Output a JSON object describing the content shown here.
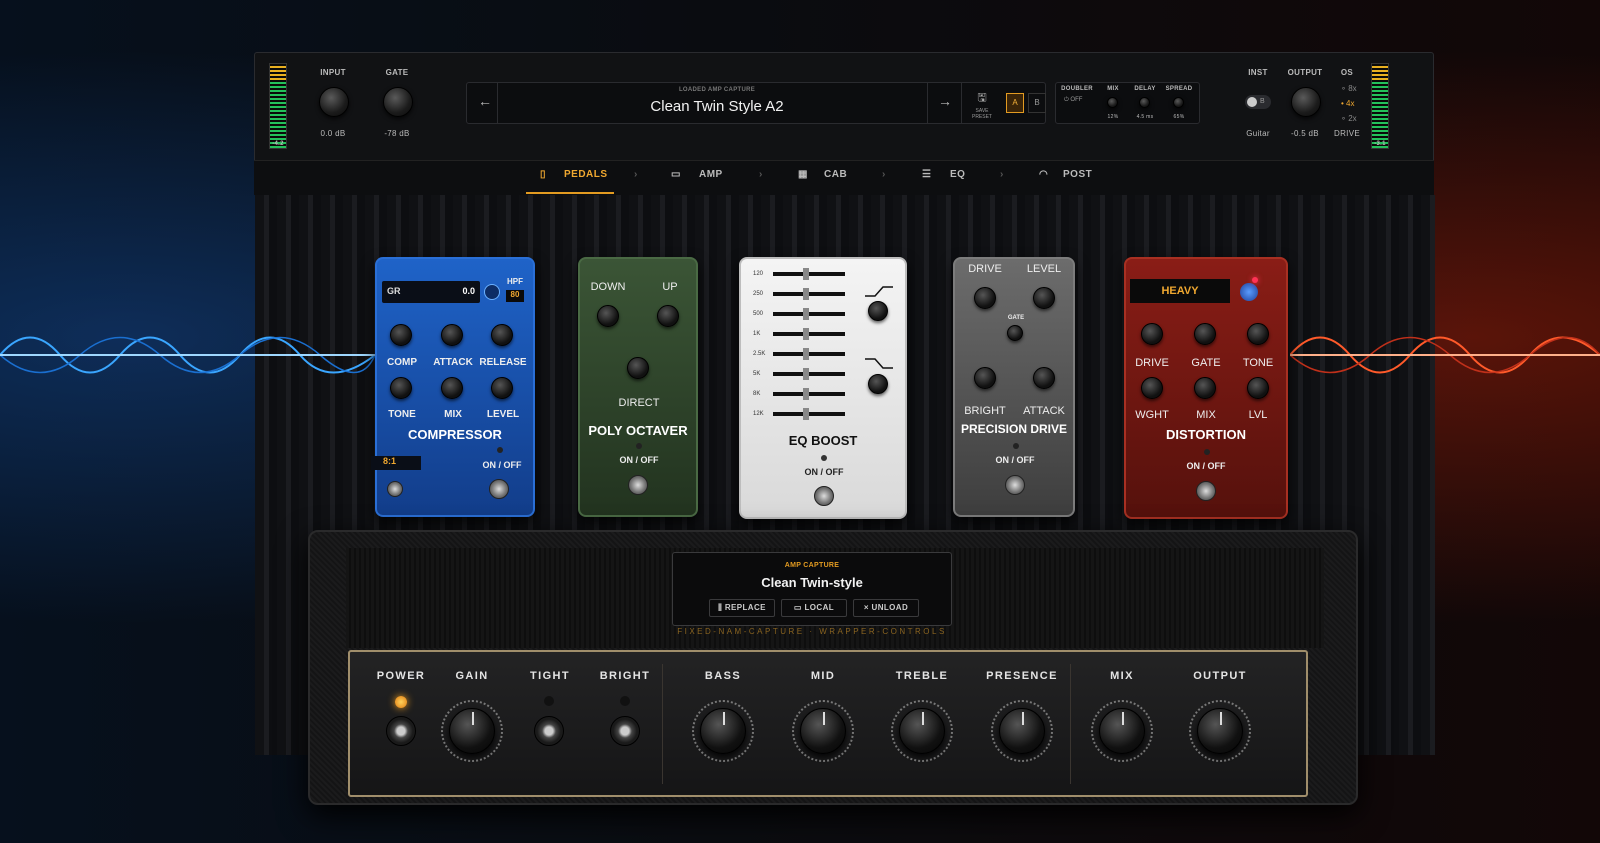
{
  "header": {
    "left_meter_value": "-4.2",
    "right_meter_value": "-3.1",
    "input": {
      "label": "INPUT",
      "value": "0.0 dB"
    },
    "gate": {
      "label": "GATE",
      "value": "-78 dB"
    },
    "preset": {
      "caption": "LOADED AMP CAPTURE",
      "name": "Clean Twin Style A2",
      "save_label": "SAVE PRESET",
      "a_label": "A",
      "b_label": "B"
    },
    "doubler": {
      "label": "DOUBLER",
      "state": "OFF",
      "mix_label": "MIX",
      "mix_value": "12%",
      "delay_label": "DELAY",
      "delay_value": "4.5 ms",
      "spread_label": "SPREAD",
      "spread_value": "65%"
    },
    "inst": {
      "label": "INST",
      "toggle_value": "B",
      "value": "Guitar"
    },
    "output": {
      "label": "OUTPUT",
      "value": "-0.5 dB"
    },
    "os": {
      "label": "OS",
      "options": [
        "8x",
        "4x",
        "2x"
      ],
      "selected": "4x",
      "footer": "DRIVE"
    }
  },
  "tabs": [
    {
      "label": "PEDALS",
      "active": true
    },
    {
      "label": "AMP"
    },
    {
      "label": "CAB"
    },
    {
      "label": "EQ"
    },
    {
      "label": "POST"
    }
  ],
  "pedals": {
    "compressor": {
      "title": "COMPRESSOR",
      "gr_label": "GR",
      "gr_value": "0.0",
      "hpf_label": "HPF",
      "hpf_value": "80",
      "labels": [
        "COMP",
        "ATTACK",
        "RELEASE",
        "TONE",
        "MIX",
        "LEVEL"
      ],
      "ratio": "8:1",
      "onoff": "ON / OFF"
    },
    "octaver": {
      "title": "POLY OCTAVER",
      "labels": [
        "DOWN",
        "UP",
        "DIRECT"
      ],
      "onoff": "ON / OFF"
    },
    "eq": {
      "title": "EQ BOOST",
      "bands": [
        "120",
        "250",
        "500",
        "1K",
        "2.5K",
        "5K",
        "8K",
        "12K"
      ],
      "onoff": "ON / OFF"
    },
    "precision": {
      "title": "PRECISION DRIVE",
      "labels": [
        "DRIVE",
        "LEVEL",
        "GATE",
        "BRIGHT",
        "ATTACK"
      ],
      "onoff": "ON / OFF"
    },
    "distortion": {
      "title": "DISTORTION",
      "mode": "HEAVY",
      "labels": [
        "DRIVE",
        "GATE",
        "TONE",
        "WGHT",
        "MIX",
        "LVL"
      ],
      "onoff": "ON / OFF"
    }
  },
  "amp": {
    "capture_caption": "AMP CAPTURE",
    "capture_name": "Clean Twin-style",
    "replace": "REPLACE",
    "local": "LOCAL",
    "unload": "UNLOAD",
    "wrapper_text": "FIXED-NAM-CAPTURE · WRAPPER-CONTROLS",
    "controls": [
      "POWER",
      "GAIN",
      "TIGHT",
      "BRIGHT",
      "BASS",
      "MID",
      "TREBLE",
      "PRESENCE",
      "MIX",
      "OUTPUT"
    ]
  }
}
